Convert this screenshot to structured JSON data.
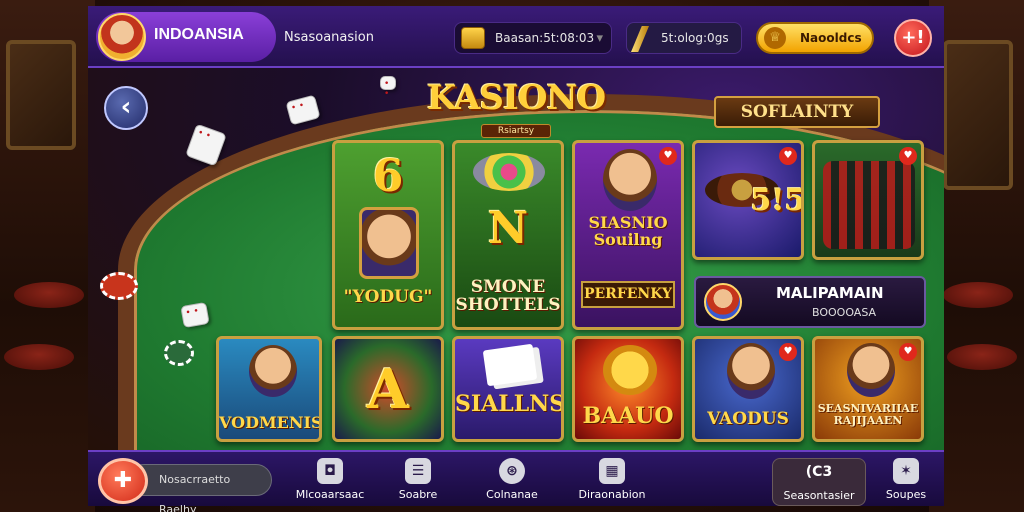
{
  "header": {
    "profile_name": "INDOANSIA",
    "status_text": "Nsasoanasion",
    "balance_label": "Baasan:5t:08:03",
    "coin_label": "5t:olog:0gs",
    "gold_button_label": "Naooldcs",
    "red_button_label": "+!"
  },
  "main": {
    "logo_title": "KASIONO",
    "logo_subtitle": "Rsiartsy",
    "banner_text": "SOFLAINTY",
    "tiles": [
      {
        "big": "6",
        "caption": "\"YODUG\""
      },
      {
        "big": "N",
        "caption": "SMONE SHOTTELS"
      },
      {
        "caption": "SIASNIO Souilng"
      },
      {
        "big": "5!5"
      },
      {},
      {
        "caption": "VODMENIS"
      },
      {
        "big": "A"
      },
      {
        "caption": "SIALLNS"
      },
      {
        "caption": "BAAUO"
      },
      {
        "caption": "VAODUS"
      },
      {
        "caption": "SEASNIVARIIAE RAJIJAAEN"
      }
    ],
    "tile3_strip": "PERFENKY",
    "promo_title": "MALIPAMAIN",
    "promo_sub": "BOOOOASA"
  },
  "bottom_nav": {
    "search_placeholder": "Nosacrraetto Raelhy",
    "items": [
      {
        "label": "Mlcoaarsaac",
        "icon": "camera-icon"
      },
      {
        "label": "Soabre",
        "icon": "stack-icon"
      },
      {
        "label": "Colnanae",
        "icon": "roulette-icon"
      },
      {
        "label": "Diraonabion",
        "icon": "grid-icon"
      },
      {
        "label": "Seasontasier",
        "icon": "chat-icon"
      },
      {
        "label": "Soupes",
        "icon": "star-icon"
      }
    ]
  },
  "colors": {
    "accent_purple": "#3a1b78",
    "gold": "#ffcf3a",
    "felt_green": "#2a8a3a"
  }
}
